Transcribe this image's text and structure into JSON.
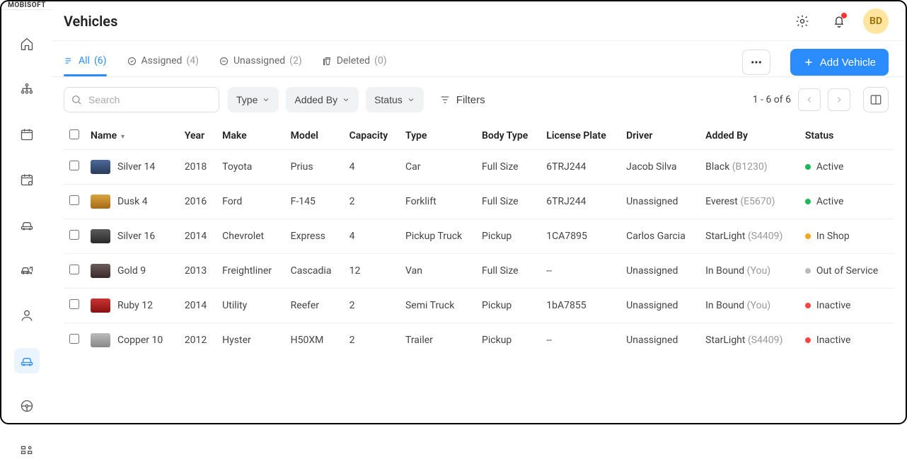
{
  "brand": "MOBISOFT",
  "page_title": "Vehicles",
  "avatar": "BD",
  "tabs": [
    {
      "label": "All",
      "count": "(6)",
      "active": true
    },
    {
      "label": "Assigned",
      "count": "(4)"
    },
    {
      "label": "Unassigned",
      "count": "(2)"
    },
    {
      "label": "Deleted",
      "count": "(0)"
    }
  ],
  "add_label": "Add Vehicle",
  "search_placeholder": "Search",
  "filter_chips": [
    "Type",
    "Added By",
    "Status"
  ],
  "filters_label": "Filters",
  "pagination": "1 - 6 of 6",
  "columns": [
    "Name",
    "Year",
    "Make",
    "Model",
    "Capacity",
    "Type",
    "Body Type",
    "License Plate",
    "Driver",
    "Added By",
    "Status"
  ],
  "rows": [
    {
      "img": "car",
      "name": "Silver 14",
      "year": "2018",
      "make": "Toyota",
      "model": "Prius",
      "capacity": "4",
      "type": "Car",
      "body": "Full Size",
      "plate": "6TRJ244",
      "driver": "Jacob Silva",
      "added": "Black",
      "added_id": "(B1230)",
      "status": "Active",
      "dot": "green"
    },
    {
      "img": "lift",
      "name": "Dusk 4",
      "year": "2016",
      "make": "Ford",
      "model": "F-145",
      "capacity": "2",
      "type": "Forklift",
      "body": "Full Size",
      "plate": "6TRJ244",
      "driver": "Unassigned",
      "added": "Everest",
      "added_id": "(E5670)",
      "status": "Active",
      "dot": "green"
    },
    {
      "img": "pickup",
      "name": "Silver 16",
      "year": "2014",
      "make": "Chevrolet",
      "model": "Express",
      "capacity": "4",
      "type": "Pickup Truck",
      "body": "Pickup",
      "plate": "1CA7895",
      "driver": "Carlos Garcia",
      "added": "StarLight",
      "added_id": "(S4409)",
      "status": "In Shop",
      "dot": "orange"
    },
    {
      "img": "van",
      "name": "Gold 9",
      "year": "2013",
      "make": "Freightliner",
      "model": "Cascadia",
      "capacity": "12",
      "type": "Van",
      "body": "Full Size",
      "plate": "--",
      "driver": "Unassigned",
      "added": "In Bound",
      "added_id": "(You)",
      "status": "Out of Service",
      "dot": "gray"
    },
    {
      "img": "semi",
      "name": "Ruby 12",
      "year": "2014",
      "make": "Utility",
      "model": "Reefer",
      "capacity": "2",
      "type": "Semi Truck",
      "body": "Pickup",
      "plate": "1bA7855",
      "driver": "Unassigned",
      "added": "In Bound",
      "added_id": "(You)",
      "status": "Inactive",
      "dot": "red"
    },
    {
      "img": "trailer",
      "name": "Copper 10",
      "year": "2012",
      "make": "Hyster",
      "model": "H50XM",
      "capacity": "2",
      "type": "Trailer",
      "body": "Pickup",
      "plate": "--",
      "driver": "Unassigned",
      "added": "StarLight",
      "added_id": "(S4409)",
      "status": "Inactive",
      "dot": "red"
    }
  ]
}
